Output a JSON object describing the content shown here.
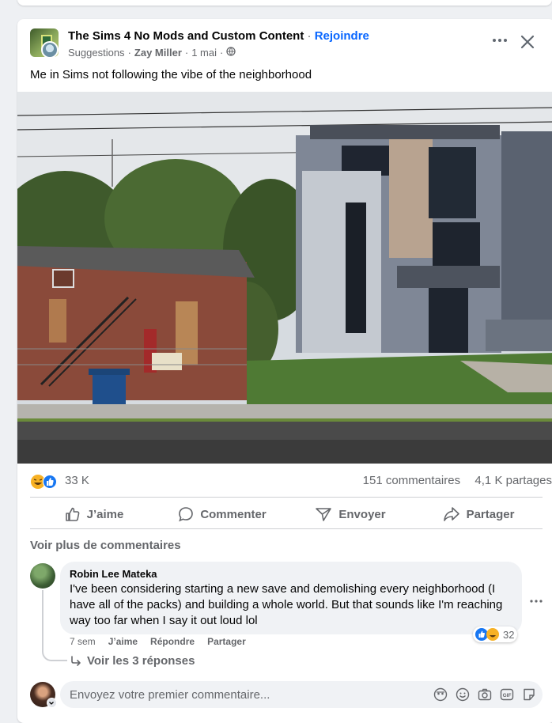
{
  "post": {
    "group_name": "The Sims 4 No Mods and Custom Content",
    "separator": "·",
    "join_label": "Rejoindre",
    "suggestion_label": "Suggestions",
    "author": "Zay Miller",
    "date": "1 mai",
    "more_icon": "more-horizontal-icon",
    "close_icon": "close-icon",
    "caption": "Me in Sims not following the vibe of the neighborhood"
  },
  "stats": {
    "reaction_count": "33 K",
    "comments_count": "151 commentaires",
    "shares_count": "4,1 K partages"
  },
  "actions": {
    "like": "J’aime",
    "comment": "Commenter",
    "send": "Envoyer",
    "share": "Partager"
  },
  "comments": {
    "see_more": "Voir plus de commentaires",
    "items": [
      {
        "author": "Robin Lee Mateka",
        "text": "I've been considering starting a new save and demolishing every neighborhood (I have all of the packs) and building a whole world. But that sounds like I'm reaching way too far when I say   it out loud lol",
        "time": "7 sem",
        "like": "J’aime",
        "reply": "Répondre",
        "share": "Partager",
        "reaction_count": "32",
        "see_replies": "Voir les 3 réponses"
      }
    ],
    "input_placeholder": "Envoyez votre premier commentaire..."
  },
  "colors": {
    "accent": "#0866ff",
    "secondary_text": "#65676b",
    "background": "#eef0f3"
  }
}
